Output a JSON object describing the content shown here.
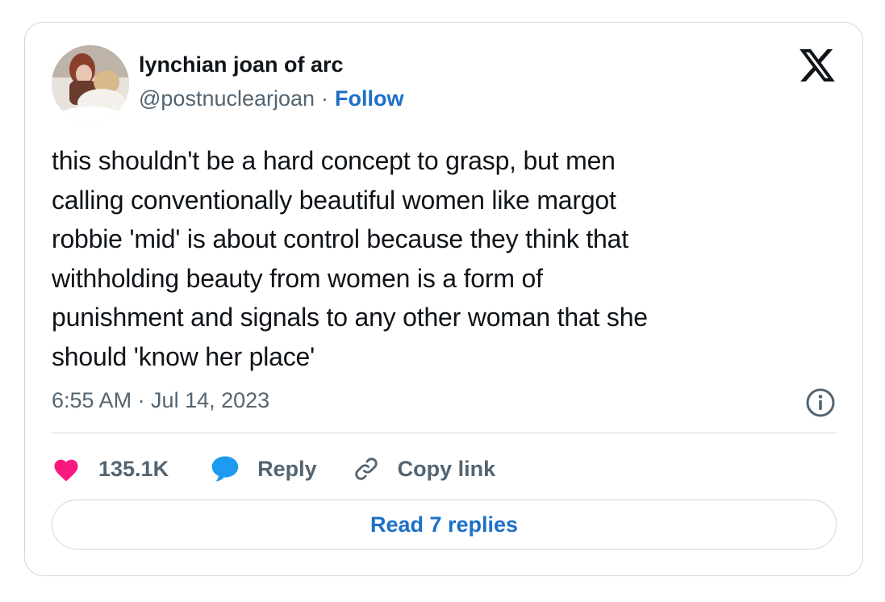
{
  "author": {
    "display_name": "lynchian joan of arc",
    "handle": "@postnuclearjoan",
    "separator": "·",
    "follow_label": "Follow",
    "avatar_icon": "profile-photo"
  },
  "tweet": {
    "text": "this shouldn't be a hard concept to grasp, but men\ncalling conventionally beautiful women like margot\nrobbie 'mid' is about control because they think that\nwithholding beauty from women is a form of\npunishment and signals to any other woman that she\nshould 'know her place'",
    "timestamp": "6:55 AM · Jul 14, 2023"
  },
  "actions": {
    "like_count": "135.1K",
    "reply_label": "Reply",
    "copy_link_label": "Copy link",
    "read_replies_label": "Read 7 replies"
  },
  "icons": {
    "brand": "x-logo-icon",
    "info": "info-icon",
    "like": "heart-icon",
    "reply": "speech-bubble-icon",
    "copy": "link-icon"
  },
  "colors": {
    "text": "#0f1419",
    "muted": "#536471",
    "link": "#1d6fc8",
    "heart": "#f91880",
    "reply_bubble": "#1d9bf0",
    "border": "#cfd9de"
  }
}
